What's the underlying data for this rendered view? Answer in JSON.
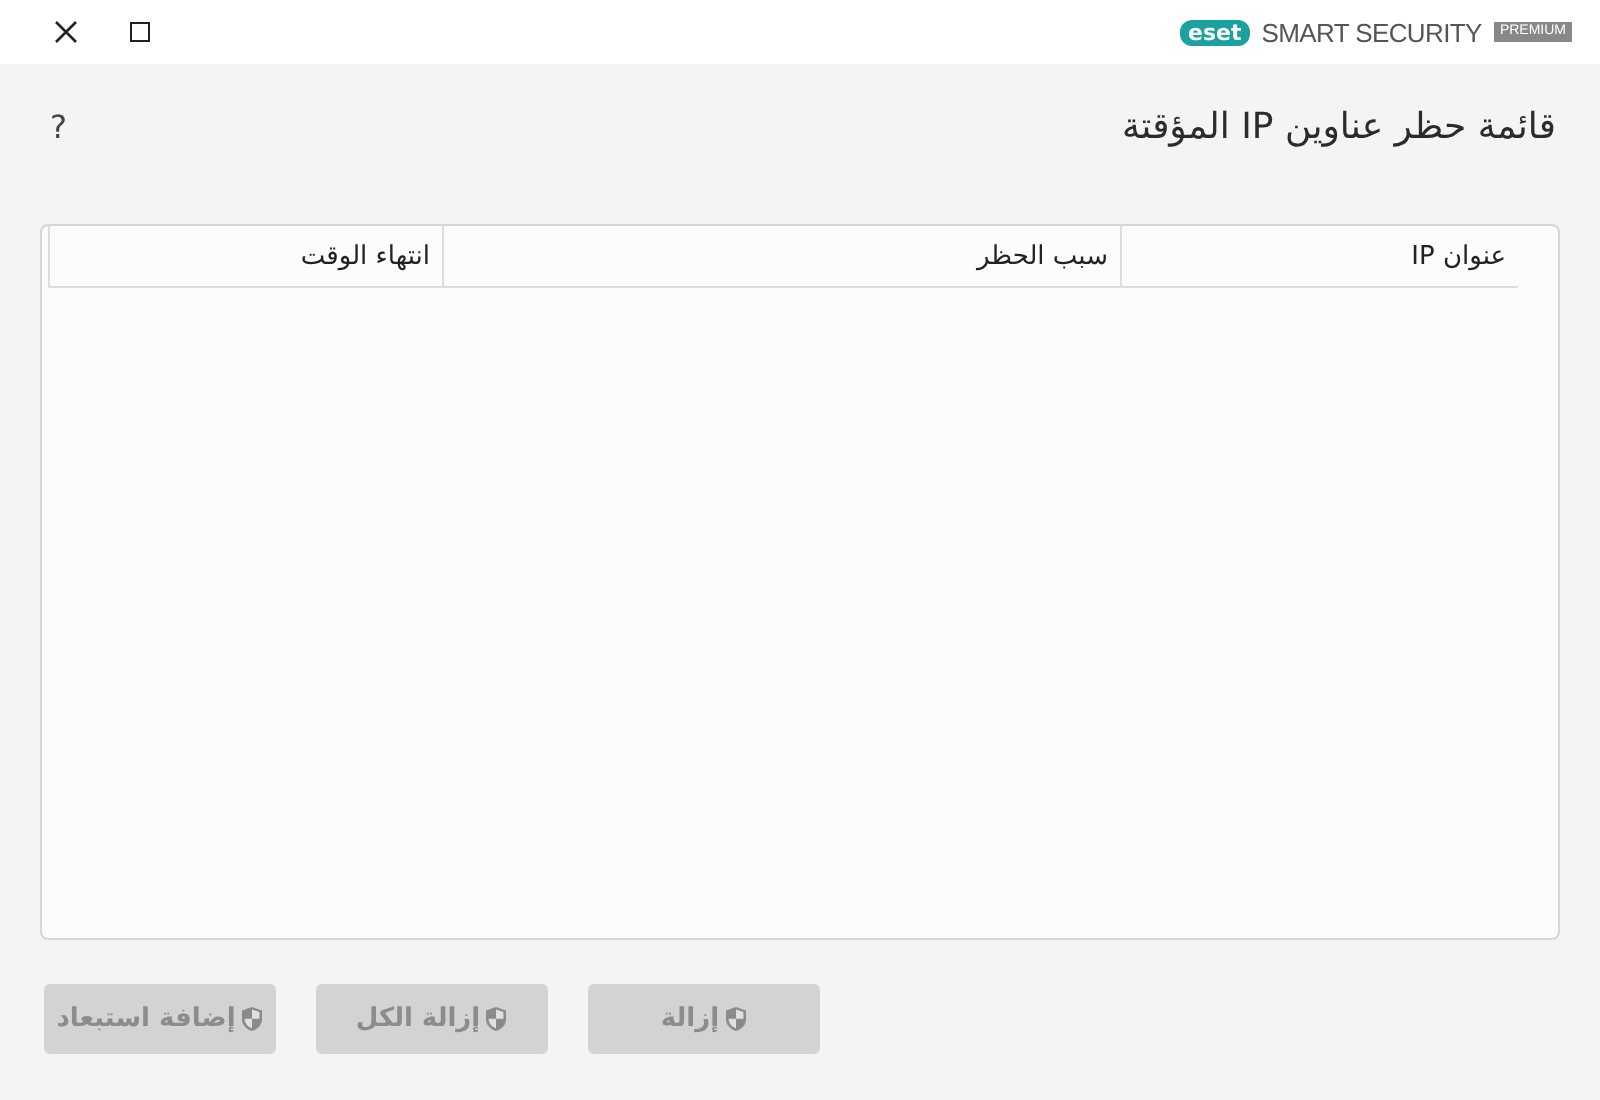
{
  "window": {
    "brand": "eset",
    "product": "SMART SECURITY",
    "edition": "PREMIUM"
  },
  "title": "قائمة حظر عناوين IP المؤقتة",
  "help": "?",
  "table": {
    "columns": [
      "عنوان IP",
      "سبب الحظر",
      "انتهاء الوقت"
    ]
  },
  "buttons": [
    {
      "label": "إزالة",
      "disabled": true
    },
    {
      "label": "إزالة الكل",
      "disabled": true
    },
    {
      "label": "إضافة استبعاد",
      "disabled": true
    }
  ]
}
